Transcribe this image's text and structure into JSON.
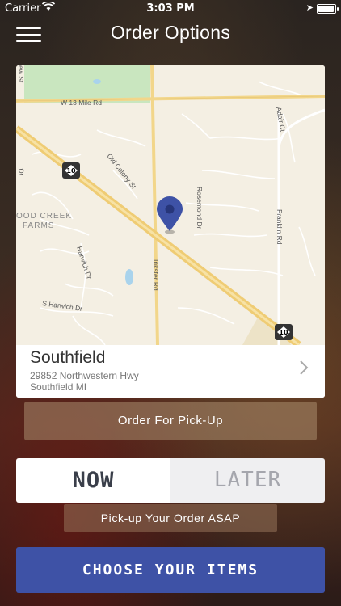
{
  "status_bar": {
    "carrier": "Carrier",
    "time": "3:03 PM"
  },
  "nav": {
    "title": "Order Options"
  },
  "map": {
    "labels": {
      "w13": "W 13 Mile Rd",
      "old_colony": "Old Colony St",
      "rosemond": "Rosemond Dr",
      "adair": "Adair Ct",
      "franklin": "Franklin Rd",
      "inkster": "Inkster Rd",
      "harwich": "Harwich Dr",
      "s_harwich": "S Harwich Dr",
      "wood_creek": "OOD CREEK",
      "farms": "FARMS",
      "route": "10",
      "ew": "ew St",
      "dr": "Dr"
    }
  },
  "location": {
    "name": "Southfield",
    "address_line1": "29852 Northwestern Hwy",
    "address_line2": "Southfield MI"
  },
  "pickup_label": "Order For Pick-Up",
  "timing": {
    "now": "NOW",
    "later": "LATER",
    "selected": "NOW"
  },
  "asap_note": "Pick-up Your Order ASAP",
  "cta": "CHOOSE YOUR ITEMS"
}
